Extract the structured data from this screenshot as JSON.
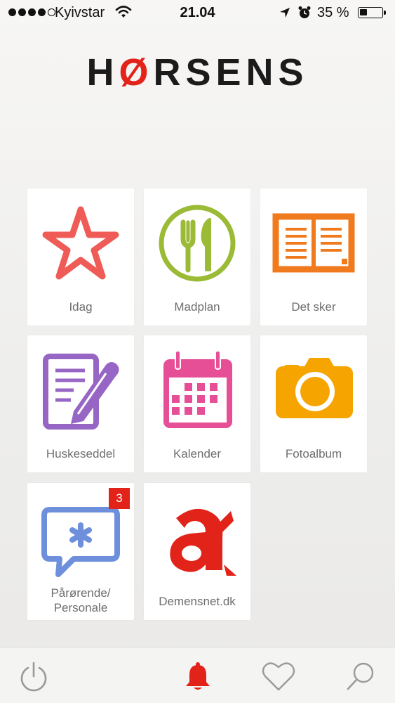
{
  "status_bar": {
    "carrier": "Kyivstar",
    "time": "21.04",
    "battery": "35 %",
    "battery_level": 0.35,
    "signal_bars_filled": 4,
    "signal_bars_total": 5
  },
  "header": {
    "logo_pre": "H",
    "logo_o": "Ø",
    "logo_post": "RSENS"
  },
  "tiles": [
    {
      "label": "Idag",
      "icon": "star-icon",
      "color": "#ef5b57"
    },
    {
      "label": "Madplan",
      "icon": "plate-cutlery-icon",
      "color": "#9bba35"
    },
    {
      "label": "Det sker",
      "icon": "open-book-icon",
      "color": "#f07a1e"
    },
    {
      "label": "Huskeseddel",
      "icon": "note-pencil-icon",
      "color": "#9765c4"
    },
    {
      "label": "Kalender",
      "icon": "calendar-icon",
      "color": "#e64f96"
    },
    {
      "label": "Fotoalbum",
      "icon": "camera-icon",
      "color": "#f6a400"
    },
    {
      "label_line1": "Pårørende/",
      "label_line2": "Personale",
      "icon": "chat-asterisk-icon",
      "color": "#6e8fdc",
      "badge": "3"
    },
    {
      "label": "Demensnet.dk",
      "icon": "demensnet-logo-icon",
      "color": "#e2231a"
    }
  ],
  "tab_bar": {
    "items": [
      {
        "icon": "power-icon"
      },
      {
        "icon": "bell-icon",
        "active_color": "#e2231a"
      },
      {
        "icon": "heart-icon"
      },
      {
        "icon": "search-icon"
      }
    ]
  }
}
